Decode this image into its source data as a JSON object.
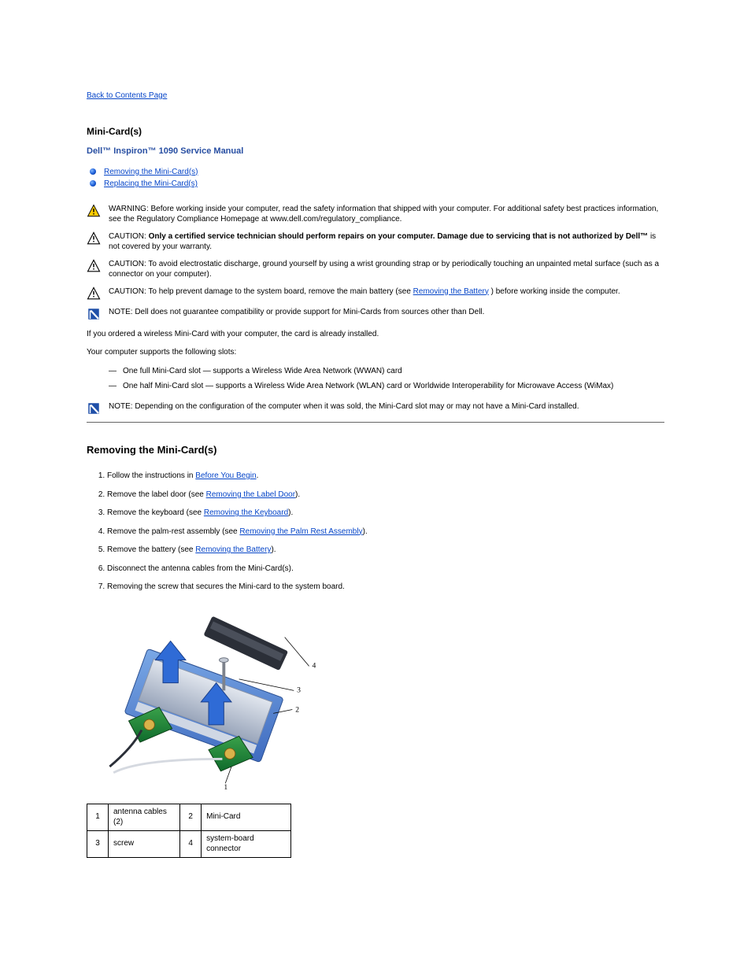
{
  "back_link": "Back to Contents Page",
  "page_title": "Mini-Card(s)",
  "manual_title": "Dell™ Inspiron™ 1090 Service Manual",
  "toc": [
    "Removing the Mini-Card(s)",
    "Replacing the Mini-Card(s)"
  ],
  "warning": "WARNING: Before working inside your computer, read the safety information that shipped with your computer. For additional safety best practices information, see the Regulatory Compliance Homepage at www.dell.com/regulatory_compliance.",
  "caution1_lead": "CAUTION: ",
  "caution1_bold": "Only a certified service technician should perform repairs on your computer. Damage due to servicing that is not authorized by Dell™",
  "caution1_tail": " is not covered by your warranty.",
  "caution2": "CAUTION: To avoid electrostatic discharge, ground yourself by using a wrist grounding strap or by periodically touching an unpainted metal surface (such as a connector on your computer).",
  "caution3_a": "CAUTION: To help prevent damage to the system board, remove the main battery (see ",
  "caution3_link": "Removing the Battery",
  "caution3_b": ") before working inside the computer.",
  "note1": "NOTE: Dell does not guarantee compatibility or provide support for Mini-Cards from sources other than Dell.",
  "intro": "If you ordered a wireless Mini-Card with your computer, the card is already installed.",
  "supports_lead": "Your computer supports the following slots:",
  "slot_full": "One full Mini-Card slot — supports a Wireless Wide Area Network (WWAN) card",
  "slot_half": "One half Mini-Card slot — supports a Wireless Wide Area Network (WLAN) card or Worldwide Interoperability for Microwave Access (WiMax)",
  "note2": "NOTE: Depending on the configuration of the computer when it was sold, the Mini-Card slot may or may not have a Mini-Card installed.",
  "section_remove": "Removing the Mini-Card(s)",
  "steps": {
    "s1a": "Follow the instructions in ",
    "s1link": "Before You Begin",
    "s1b": ".",
    "s2a": "Remove the label door (see ",
    "s2link": "Removing the Label Door",
    "s2b": ").",
    "s3a": "Remove the keyboard (see ",
    "s3link": "Removing the Keyboard",
    "s3b": ").",
    "s4a": "Remove the palm-rest assembly (see ",
    "s4link": "Removing the Palm Rest Assembly",
    "s4b": ").",
    "s5a": "Remove the battery (see ",
    "s5link": "Removing the Battery",
    "s5b": ").",
    "s6": "Disconnect the antenna cables from the Mini-Card(s).",
    "s7": "Removing the screw that secures the Mini-card to the system board."
  },
  "legend": {
    "r1c1": "1",
    "r1c2": "antenna cables (2)",
    "r1c3": "2",
    "r1c4": "Mini-Card",
    "r2c1": "3",
    "r2c2": "screw",
    "r2c3": "4",
    "r2c4": "system-board connector"
  }
}
